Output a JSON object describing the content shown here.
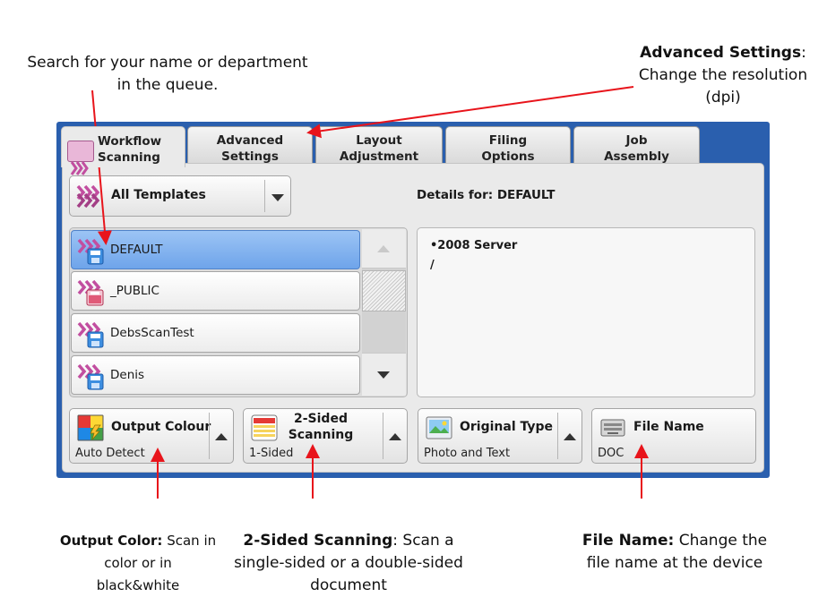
{
  "tabs": [
    {
      "label": "Workflow\nScanning",
      "active": true
    },
    {
      "label": "Advanced\nSettings",
      "active": false
    },
    {
      "label": "Layout\nAdjustment",
      "active": false
    },
    {
      "label": "Filing\nOptions",
      "active": false
    },
    {
      "label": "Job\nAssembly",
      "active": false
    }
  ],
  "template_filter": {
    "selected": "All Templates"
  },
  "details": {
    "title": "Details for: DEFAULT",
    "lines": [
      "•2008 Server",
      "/"
    ]
  },
  "templates": [
    {
      "name": "DEFAULT",
      "selected": true,
      "icon": "template-disk-icon"
    },
    {
      "name": "_PUBLIC",
      "selected": false,
      "icon": "template-public-icon"
    },
    {
      "name": "DebsScanTest",
      "selected": false,
      "icon": "template-disk-icon"
    },
    {
      "name": "Denis",
      "selected": false,
      "icon": "template-disk-icon"
    }
  ],
  "features": [
    {
      "title": "Output Colour",
      "value": "Auto Detect",
      "icon": "color-palette-icon"
    },
    {
      "title": "2-Sided\nScanning",
      "value": "1-Sided",
      "icon": "two-sided-icon"
    },
    {
      "title": "Original Type",
      "value": "Photo and Text",
      "icon": "photo-icon"
    },
    {
      "title": "File Name",
      "value": "DOC",
      "icon": "file-name-icon"
    }
  ],
  "annotations": {
    "search": "Search for your name or department\nin the queue.",
    "advanced_bold": "Advanced Settings",
    "advanced_rest": ":\nChange the resolution\n(dpi)",
    "output_bold": "Output Color:",
    "output_rest": " Scan in\ncolor or in\nblack&white",
    "twosided_bold": "2-Sided Scanning",
    "twosided_rest": ": Scan a\nsingle-sided or a double-sided\ndocument",
    "filename_bold": "File Name:",
    "filename_rest": " Change the\nfile name at the device"
  },
  "colors": {
    "panel_blue": "#2a5fae",
    "selection_blue": "#7aaeee",
    "arrow_red": "#e8141b",
    "template_pink": "#c24ea0"
  }
}
